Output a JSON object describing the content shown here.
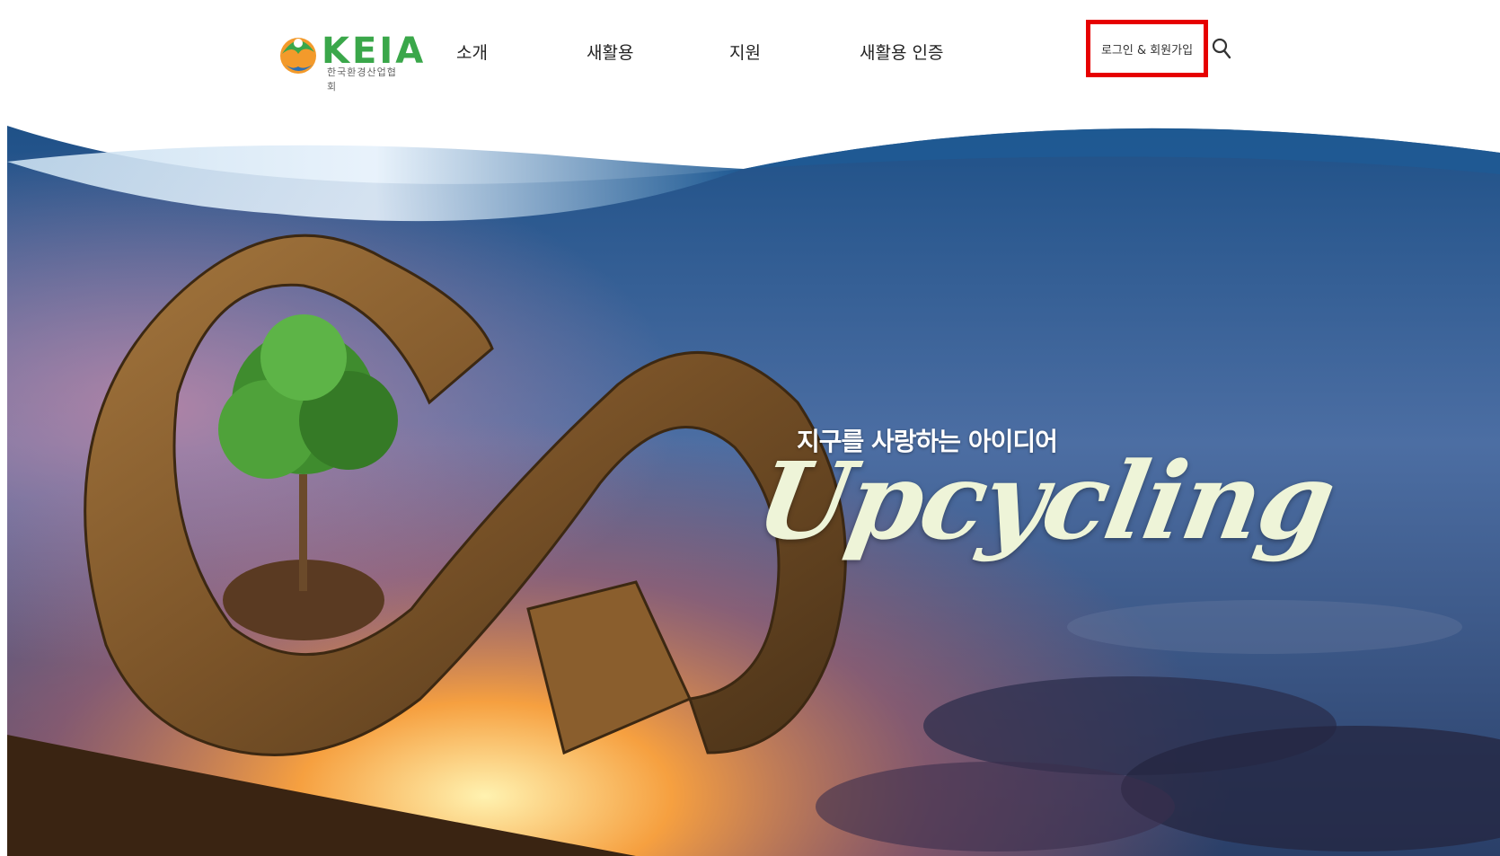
{
  "brand": {
    "name": "KEIA",
    "subtitle": "한국환경산업협회"
  },
  "nav": {
    "items": [
      "소개",
      "새활용",
      "지원",
      "새활용 인증"
    ],
    "login_label": "로그인 & 회원가입",
    "search_icon": "search-icon"
  },
  "hero": {
    "tagline": "지구를 사랑하는 아이디어",
    "headline": "Upcycling"
  },
  "colors": {
    "brand_green": "#3aa74a",
    "highlight_red": "#e60000",
    "sky_blue": "#1f4f8a"
  }
}
